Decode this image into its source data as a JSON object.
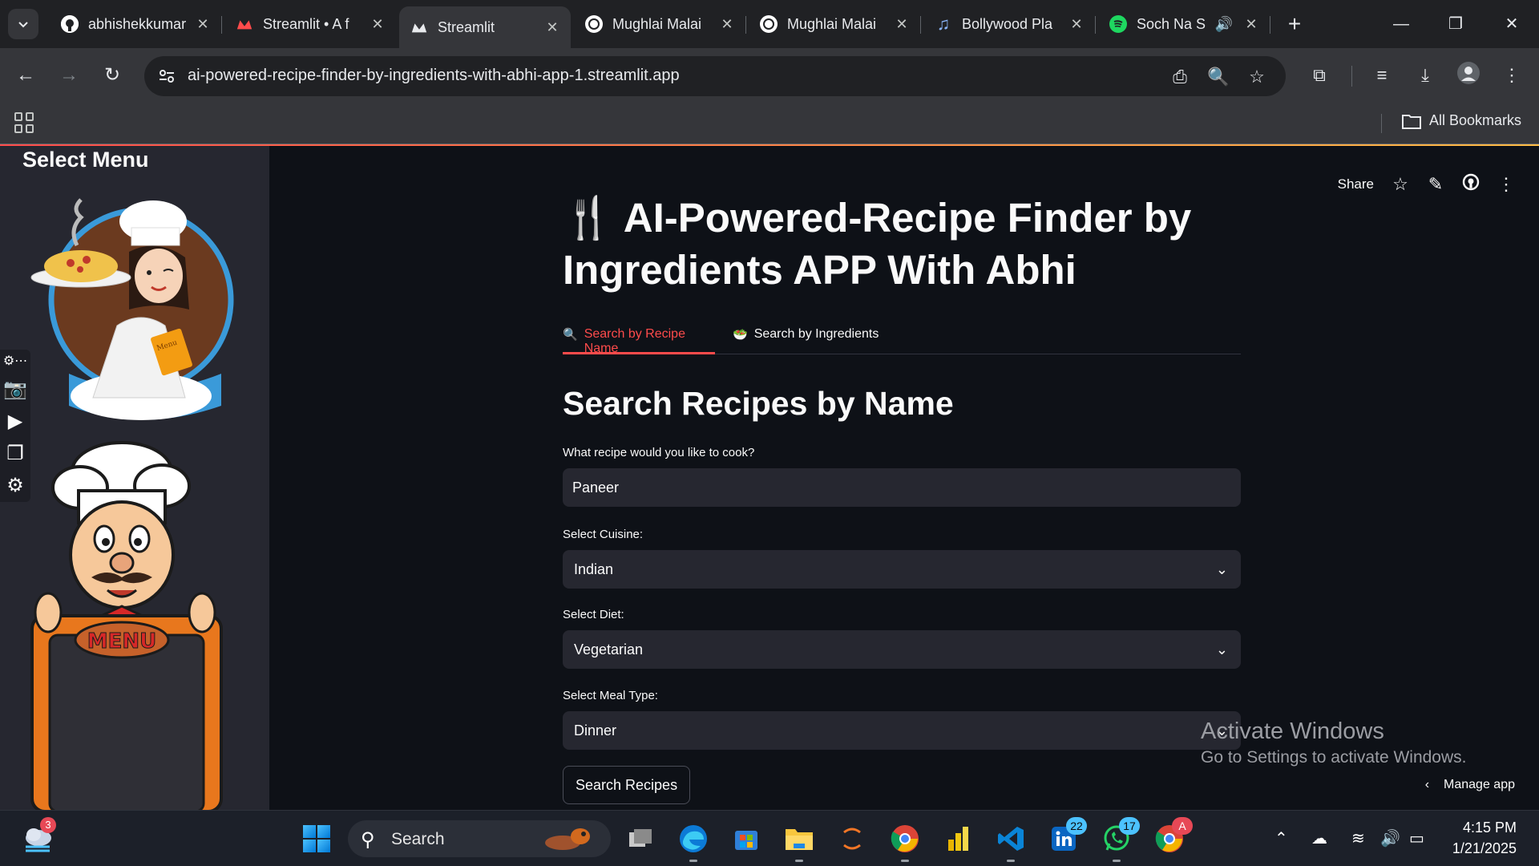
{
  "browser": {
    "tabs": [
      {
        "title": "abhishekkumar",
        "favicon": "github-icon"
      },
      {
        "title": "Streamlit • A f",
        "favicon": "streamlit-icon"
      },
      {
        "title": "Streamlit",
        "favicon": "streamlit-icon",
        "active": true
      },
      {
        "title": "Mughlai Malai",
        "favicon": "chatgpt-icon"
      },
      {
        "title": "Mughlai Malai",
        "favicon": "chatgpt-icon"
      },
      {
        "title": "Bollywood Pla",
        "favicon": "music-note-icon"
      },
      {
        "title": "Soch Na S",
        "favicon": "spotify-icon",
        "audio": true
      }
    ],
    "url": "ai-powered-recipe-finder-by-ingredients-with-abhi-app-1.streamlit.app",
    "bookmarks_label": "All Bookmarks"
  },
  "sidebar": {
    "title": "Select Menu",
    "chef_board_text": "MENU",
    "chef_card_text": "Menu"
  },
  "header": {
    "share_label": "Share"
  },
  "main": {
    "title_emoji": "🍴",
    "title": "AI-Powered-Recipe Finder by Ingredients APP With Abhi",
    "tabs": [
      {
        "icon": "🔍",
        "label": "Search by Recipe Name",
        "active": true
      },
      {
        "icon": "🥗",
        "label": "Search by Ingredients",
        "active": false
      }
    ],
    "section_title": "Search Recipes by Name",
    "recipe_label": "What recipe would you like to cook?",
    "recipe_value": "Paneer",
    "cuisine_label": "Select Cuisine:",
    "cuisine_value": "Indian",
    "diet_label": "Select Diet:",
    "diet_value": "Vegetarian",
    "meal_label": "Select Meal Type:",
    "meal_value": "Dinner",
    "search_button": "Search Recipes"
  },
  "overlay": {
    "activate_title": "Activate Windows",
    "activate_sub": "Go to Settings to activate Windows.",
    "manage_app": "Manage app"
  },
  "taskbar": {
    "weather_badge": "3",
    "search_label": "Search",
    "linkedin_badge": "22",
    "whatsapp_badge": "17",
    "chrome_badge": "A",
    "time": "4:15 PM",
    "date": "1/21/2025"
  },
  "colors": {
    "accent": "#ff4b4b",
    "background": "#0e1117",
    "sidebar": "#262730",
    "input": "#262730"
  }
}
